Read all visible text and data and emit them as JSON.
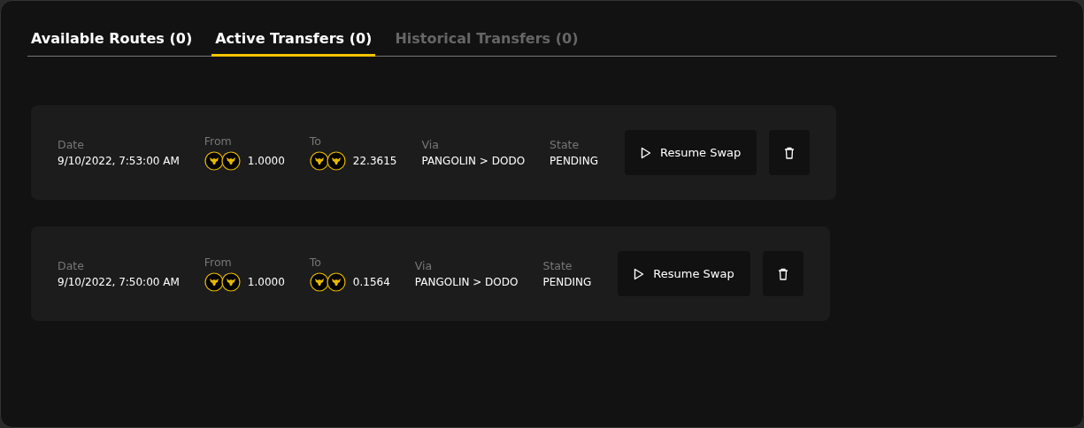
{
  "tabs": [
    {
      "label": "Available Routes (0)",
      "selected": false,
      "disabled": false
    },
    {
      "label": "Active Transfers (0)",
      "selected": true,
      "disabled": false
    },
    {
      "label": "Historical Transfers (0)",
      "selected": false,
      "disabled": true
    }
  ],
  "transfers": [
    {
      "date_label": "Date",
      "date": "9/10/2022, 7:53:00 AM",
      "from_label": "From",
      "from_amount": "1.0000",
      "to_label": "To",
      "to_amount": "22.3615",
      "via_label": "Via",
      "via": "PANGOLIN > DODO",
      "state_label": "State",
      "state": "PENDING",
      "action": "Resume Swap"
    },
    {
      "date_label": "Date",
      "date": "9/10/2022, 7:50:00 AM",
      "from_label": "From",
      "from_amount": "1.0000",
      "to_label": "To",
      "to_amount": "0.1564",
      "via_label": "Via",
      "via": "PANGOLIN > DODO",
      "state_label": "State",
      "state": "PENDING",
      "action": "Resume Swap"
    }
  ]
}
